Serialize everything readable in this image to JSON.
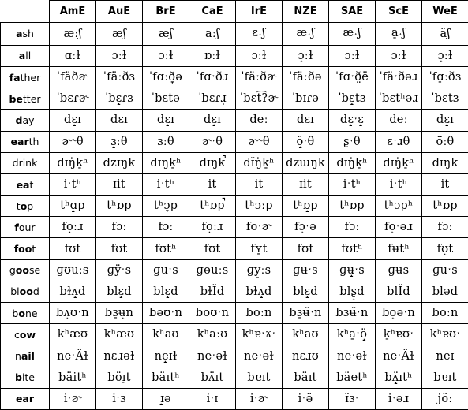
{
  "table": {
    "corner_label": "",
    "columns": [
      "AmE",
      "AuE",
      "BrE",
      "CaE",
      "IrE",
      "NZE",
      "SAE",
      "ScE",
      "WeE"
    ],
    "rows": [
      {
        "keyword": "ash",
        "bold_prefix": "a",
        "rest": "sh",
        "cells": [
          "æːʃ",
          "æʃ",
          "æʃ",
          "aːʃ",
          "ɛ˔ʃ",
          "æ˔ʃ",
          "æ˔ʃ",
          "a̠˔ʃ",
          "ӓʃ"
        ]
      },
      {
        "keyword": "all",
        "bold_prefix": "a",
        "rest": "ll",
        "cells": [
          "ɑːɫ",
          "ɔːɫ",
          "ɔːɫ",
          "ɒːɫ",
          "ɔːɫ",
          "ɔ̝ːɫ",
          "ɔːɫ",
          "ɔːɫ",
          "ɔ̝ːɫ"
        ]
      },
      {
        "keyword": "father",
        "bold_prefix": "fa",
        "rest": "ther",
        "cells": [
          "ˈfӓðɚ",
          "ˈfӓːðɜ",
          "ˈfɑːð̞ə",
          "ˈfɑˑðɹ",
          "ˈfӓːðɚ",
          "ˈfӓːðə",
          "ˈfɑˑð̤ë",
          "ˈfӓˑðəɹ",
          "ˈfɑ̠ːðɜ"
        ]
      },
      {
        "keyword": "better",
        "bold_prefix": "be",
        "rest": "tter",
        "cells": [
          "ˈbɛɾɚ",
          "ˈbɛ̝ɾɜ",
          "ˈbɛtə",
          "ˈbɛɾɹ̩",
          "ˈbɛt͡ʔɚ",
          "ˈbɪɾə",
          "ˈbɛ̝tɜ",
          "ˈbɛtʰəɹ",
          "ˈbɛtɜ"
        ]
      },
      {
        "keyword": "day",
        "bold_prefix": "d",
        "rest": "ay",
        "bold_suffix": true,
        "cells": [
          "dɛ̝ɪ",
          "dɛɪ",
          "dɛ̝ɪ",
          "dɛ̝ɪ",
          "deː",
          "dɛɪ",
          "dɛ̝ˑɛ̝",
          "deː",
          "dɛ̝ɪ"
        ]
      },
      {
        "keyword": "earth",
        "bold_prefix": "ear",
        "rest": "th",
        "cells": [
          "ɚ˞θ",
          "ɜ̝ːθ",
          "ɜːθ",
          "ɚˑθ",
          "ɚ˞θ",
          "ö̝ˑθ",
          "ʂˑθ",
          "ɛˑɹθ",
          "ö̈ːθ"
        ]
      },
      {
        "keyword": "drink",
        "bold_prefix": "",
        "rest": "drink",
        "cells": [
          "dɪŋ̍k̠ʰ",
          "dzɪŋk",
          "dɪŋk̠ʰ",
          "dɪŋk̚",
          "dɪ̈ŋ̍k̠ʰ",
          "dzɯŋk",
          "dɪŋ̍k̠ʰ",
          "dɪŋ̍k̠ʰ",
          "dɪŋk"
        ]
      },
      {
        "keyword": "eat",
        "bold_prefix": "ea",
        "rest": "t",
        "cells": [
          "iˑtʰ",
          "ɪit",
          "iˑtʰ",
          "it",
          "it",
          "ɪit",
          "iˑtʰ",
          "iˑtʰ",
          "it"
        ]
      },
      {
        "keyword": "top",
        "bold_prefix": "t",
        "rest": "op",
        "bold_middle": "o",
        "cells": [
          "tʰɑ̝p",
          "tʰɒp",
          "tʰɔ̞p",
          "tʰɒp̚",
          "tʰɔːp",
          "tʰɒ̝p",
          "tʰɒp",
          "tʰɔpʰ",
          "tʰɒp"
        ]
      },
      {
        "keyword": "four",
        "bold_prefix": "f",
        "rest": "our",
        "cells": [
          "fo̝ːɹ",
          "fɔː",
          "fɔː",
          "fo̝ːɹ",
          "foˑɚ",
          "fɔ̝ˑə",
          "fɔː",
          "fo̝ˑəɹ",
          "fɔː"
        ]
      },
      {
        "keyword": "foot",
        "bold_prefix": "foo",
        "rest": "t",
        "cells": [
          "fʊt",
          "fʊt",
          "fʊtʰ",
          "fʊt",
          "fʏ̠t",
          "fʊt",
          "fʊtʰ",
          "fʉtʰ",
          "fʊ̝t"
        ]
      },
      {
        "keyword": "goose",
        "bold_prefix": "g",
        "rest": "oose",
        "bold_middle": "oo",
        "cells": [
          "ɡʊuːs",
          "ɡÿˑs",
          "ɡuˑs",
          "ɡɵuːs",
          "ɡy̠ːs",
          "ɡʉˑs",
          "ɡʉ̝ˑs",
          "ɡʉs",
          "ɡuˑs"
        ]
      },
      {
        "keyword": "blood",
        "bold_prefix": "bl",
        "rest": "ood",
        "bold_middle": "oo",
        "cells": [
          "bɫʌ̝d",
          "blɛ̝d",
          "blɛ̝d",
          "bɫÏd",
          "bɫʌ̝d",
          "blɛ̝d",
          "blʂ̝d",
          "blÏd",
          "bləd"
        ]
      },
      {
        "keyword": "bone",
        "bold_prefix": "b",
        "rest": "one",
        "bold_middle": "o",
        "cells": [
          "bʌ̝ʊˑn",
          "bɜ̠ʉ̝n",
          "bəʊˑn",
          "boʊˑn",
          "boːn",
          "bɜ̠ʉ̈ˑn",
          "bɜʉ̈ˑn",
          "bo̝əˑn",
          "boːn"
        ]
      },
      {
        "keyword": "cow",
        "bold_prefix": "c",
        "rest": "ow",
        "bold_middle": "ow",
        "cells": [
          "kʰæʊ",
          "kʰæʊ",
          "kʰaʊ",
          "kʰaːʊ",
          "kʰɐˑɤˑ",
          "kʰaʊ",
          "kʰa̠ˑö̝",
          "k̠ʰɐʊˑ",
          "kʰɐʊˑ"
        ]
      },
      {
        "keyword": "nail",
        "bold_prefix": "n",
        "rest": "ail",
        "bold_middle": "ail",
        "cells": [
          "neˑÄɫ",
          "nɛɹəɫ",
          "ne̝ɪɫ",
          "neˑəɫ",
          "neˑəɫ",
          "nɛɹʊ",
          "neˑəɫ",
          "neˑÄɫ",
          "neɪ"
        ]
      },
      {
        "keyword": "bite",
        "bold_prefix": "b",
        "rest": "ite",
        "cells": [
          "bӓitʰ",
          "bӧɪ̠t",
          "bӓɪtʰ",
          "bʌ̈ɪt",
          "bɐɪt",
          "bӓɪt",
          "bӓetʰ",
          "bʌ̝̈ɪtʰ",
          "bɐɪt"
        ]
      },
      {
        "keyword": "ear",
        "bold_prefix": "ear",
        "rest": "",
        "cells": [
          "iˑɚ",
          "iˑɜ",
          "ɪ̝ə",
          "iˑɪ̩",
          "iˑɚ",
          "iˑə̈",
          "ɪ̈ɜˑ",
          "iˑəɹ",
          "jöː"
        ]
      }
    ]
  }
}
